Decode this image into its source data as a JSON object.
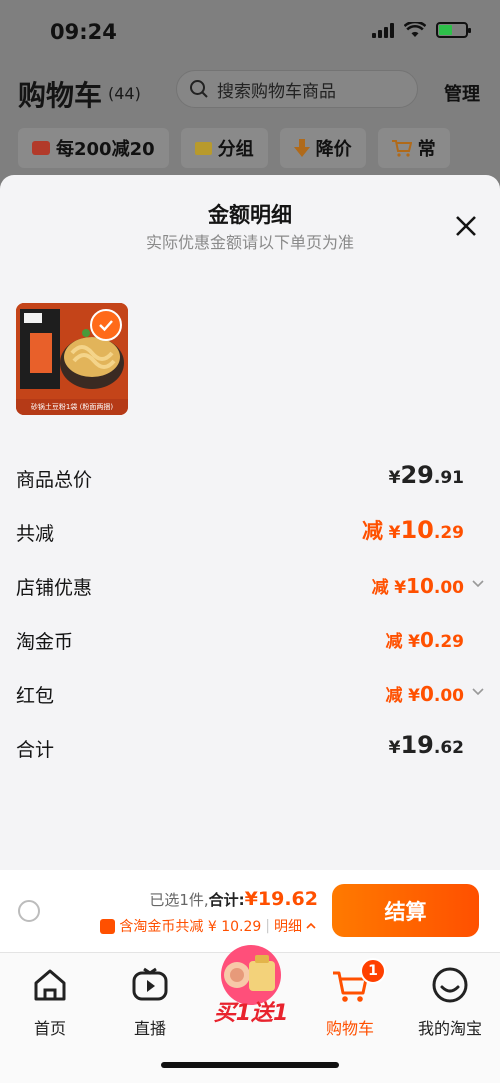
{
  "status": {
    "time": "09:24"
  },
  "cart": {
    "title": "购物车",
    "count": "(44)",
    "search_placeholder": "搜索购物车商品",
    "manage_label": "管理",
    "filters": [
      {
        "label": "每200减20",
        "icon": "wallet-icon"
      },
      {
        "label": "分组",
        "icon": "folder-icon"
      },
      {
        "label": "降价",
        "icon": "price-drop-icon"
      },
      {
        "label": "常",
        "icon": "cart-icon"
      }
    ]
  },
  "sheet": {
    "title": "金额明细",
    "subtitle": "实际优惠金额请以下单页为准",
    "product": {
      "caption": "砂锅土豆粉1袋 (粉面两捆)"
    },
    "rows": [
      {
        "label": "商品总价",
        "prefix": "",
        "yen": "¥",
        "main": "29",
        "decimal": ".91",
        "style": "plain"
      },
      {
        "label": "共减",
        "prefix": "减",
        "yen": "¥",
        "main": "10",
        "decimal": ".29",
        "style": "orange-big"
      },
      {
        "label": "店铺优惠",
        "prefix": "减",
        "yen": "¥",
        "main": "10",
        "decimal": ".00",
        "style": "orange-small"
      },
      {
        "label": "淘金币",
        "prefix": "减",
        "yen": "¥",
        "main": "0",
        "decimal": ".29",
        "style": "orange-small"
      },
      {
        "label": "红包",
        "prefix": "减",
        "yen": "¥",
        "main": "0",
        "decimal": ".00",
        "style": "orange-small"
      },
      {
        "label": "合计",
        "prefix": "",
        "yen": "¥",
        "main": "19",
        "decimal": ".62",
        "style": "plain"
      }
    ]
  },
  "checkout": {
    "selected_text": "已选1件,",
    "total_label": "合计:",
    "total_value": "¥19.62",
    "discount_text": "含淘金币共减 ¥ 10.29",
    "detail_link": "明细",
    "button_label": "结算"
  },
  "tabs": [
    {
      "label": "首页",
      "icon": "home-icon"
    },
    {
      "label": "直播",
      "icon": "live-icon"
    },
    {
      "label": "买1送1",
      "icon": "promo-icon"
    },
    {
      "label": "购物车",
      "icon": "cart-icon",
      "badge": "1"
    },
    {
      "label": "我的淘宝",
      "icon": "profile-icon"
    }
  ],
  "colors": {
    "accent": "#ff5000",
    "sheet_bg": "#f4f4f6",
    "overlay": "#7f7f7f"
  }
}
